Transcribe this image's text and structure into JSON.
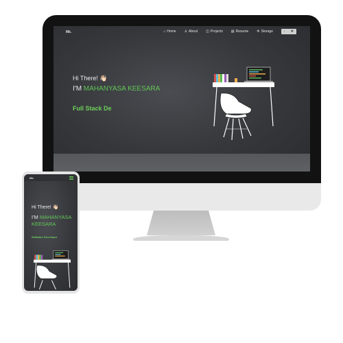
{
  "desktop": {
    "nav": {
      "logo": "Mk.",
      "links": [
        {
          "icon": "home-icon",
          "glyph": "⌂",
          "label": "Home"
        },
        {
          "icon": "user-icon",
          "glyph": "♙",
          "label": "About"
        },
        {
          "icon": "projects-icon",
          "glyph": "◫",
          "label": "Projects"
        },
        {
          "icon": "resume-icon",
          "glyph": "▤",
          "label": "Resume"
        },
        {
          "icon": "storage-icon",
          "glyph": "✲",
          "label": "Storage"
        }
      ],
      "toggle_left": "⁝",
      "toggle_right": "✱"
    },
    "hero": {
      "greeting": "Hi There! 👋🏻",
      "im": "I'M ",
      "name": "MAHANYASA KEESARA",
      "role": "Full Stack De"
    }
  },
  "phone": {
    "logo": "Mk.",
    "greeting": "Hi There! 👋🏻",
    "im": "I'M ",
    "name": "MAHANYASA KEESARA",
    "role": "Software Developer"
  },
  "colors": {
    "accent": "#62c655",
    "screen_bg": "#35373b",
    "monitor_frame": "#121212"
  }
}
